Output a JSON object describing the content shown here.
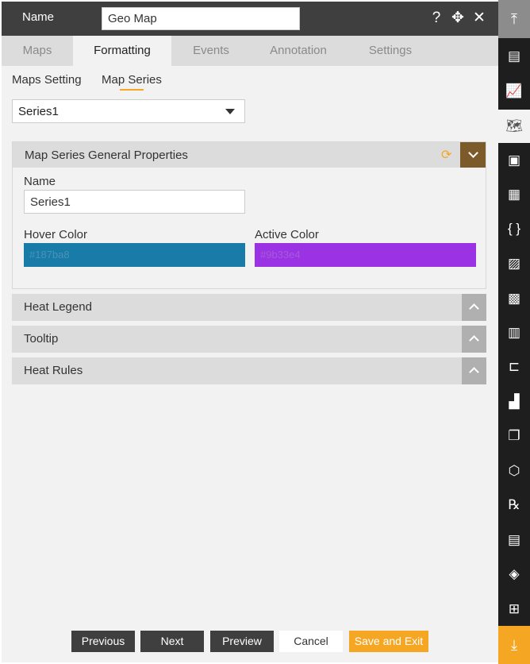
{
  "header": {
    "name_label": "Name",
    "name_value": "Geo Map",
    "icons": [
      "help-icon",
      "move-icon",
      "close-icon"
    ]
  },
  "tabs": [
    {
      "label": "Maps"
    },
    {
      "label": "Formatting",
      "active": true
    },
    {
      "label": "Events"
    },
    {
      "label": "Annotation"
    },
    {
      "label": "Settings"
    }
  ],
  "subtabs": [
    {
      "label": "Maps Setting"
    },
    {
      "label": "Map Series",
      "active": true
    }
  ],
  "series_select": {
    "value": "Series1"
  },
  "general": {
    "title": "Map Series General Properties",
    "name_label": "Name",
    "name_value": "Series1",
    "hover_label": "Hover Color",
    "hover_value": "#187ba8",
    "active_label": "Active Color",
    "active_value": "#9b33e4"
  },
  "sections": [
    {
      "label": "Heat Legend"
    },
    {
      "label": "Tooltip"
    },
    {
      "label": "Heat Rules"
    }
  ],
  "footer": {
    "previous": "Previous",
    "next": "Next",
    "preview": "Preview",
    "cancel": "Cancel",
    "save_exit": "Save and Exit"
  },
  "colors": {
    "accent": "#f5a623",
    "header": "#3f3f3f",
    "hover_swatch": "#187ba8",
    "active_swatch": "#9b33e4"
  },
  "sidebar_icons": [
    "scroll-top-icon",
    "table-icon",
    "chart-icon",
    "map-icon",
    "report-icon",
    "document-icon",
    "code-icon",
    "image-icon",
    "calendar-icon",
    "spreadsheet-icon",
    "tree-icon",
    "bar-chart-icon",
    "pages-icon",
    "cubes-icon",
    "rx-icon",
    "note-icon",
    "layers-icon",
    "widgets-icon",
    "scroll-bottom-icon"
  ]
}
